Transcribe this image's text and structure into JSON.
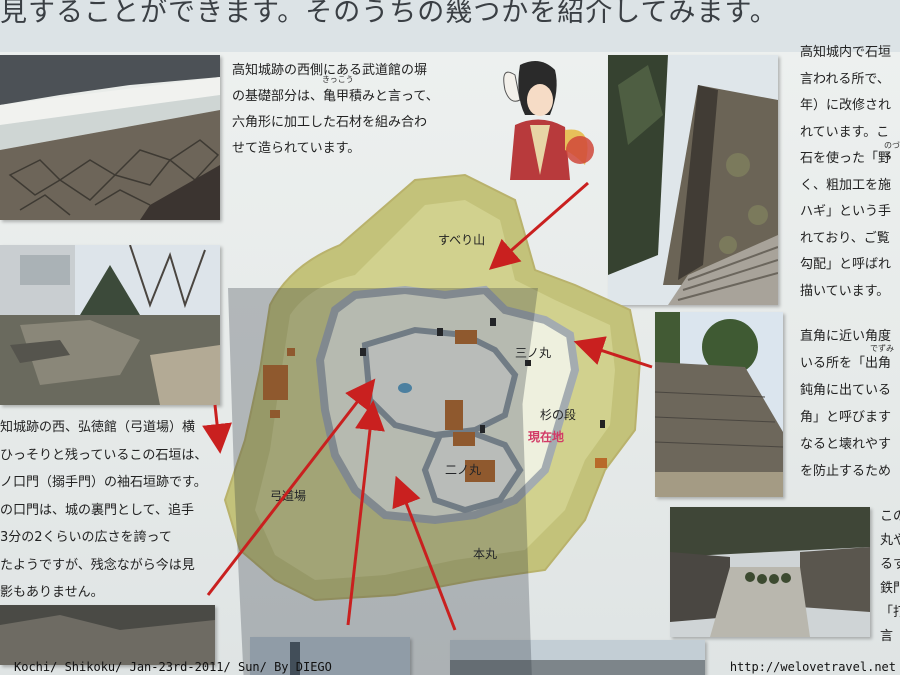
{
  "headline": "見することができます。そのうちの幾つかを紹介してみます。",
  "top_text": {
    "lines": [
      "高知城跡の西側にある武道館の塀",
      "の基礎部分は、亀甲積みと言って、",
      "六角形に加工した石材を組み合わ",
      "せて造られています。"
    ],
    "ruby": "きっこう"
  },
  "left_text": {
    "lines": [
      "知城跡の西、弘徳館（弓道場）横",
      "ひっそりと残っているこの石垣は、",
      "ノ口門（搦手門）の袖石垣跡です。",
      "の口門は、城の裏門として、追手",
      "3分の2くらいの広さを誇って",
      "たようですが、残念ながら今は見",
      "影もありません。"
    ]
  },
  "right_text_top": {
    "lines": [
      "高知城内で石垣",
      "言われる所で、",
      "年）に改修され",
      "れています。こ",
      "石を使った「野",
      "く、粗加工を施",
      "ハギ」という手",
      "れており、ご覧",
      "勾配」と呼ばれ",
      "描いています。"
    ],
    "ruby": "のづら"
  },
  "right_text_mid": {
    "lines": [
      "直角に近い角度",
      "いる所を「出角",
      "鈍角に出ている",
      "角」と呼びます",
      "なると壊れやす",
      "を防止するため"
    ],
    "ruby": "でずみ"
  },
  "right_text_bottom": {
    "lines": [
      "この",
      "丸や",
      "るす",
      "鉄門",
      "「打",
      "言"
    ]
  },
  "map_labels": {
    "suberi": "すべり山",
    "sannomaru": "三ノ丸",
    "suginodan": "杉の段",
    "current": "現在地",
    "ninomaru": "二ノ丸",
    "kyudojo": "弓道場",
    "honmaru": "本丸"
  },
  "footer": {
    "left": "Kochi/ Shikoku/ Jan-23rd-2011/ Sun/ By DIEGO",
    "right": "http://welovetravel.net"
  },
  "colors": {
    "map_fill": "#c3c27a",
    "map_edge": "#b9b26c",
    "path_fill": "#d9dbb4",
    "castle_gray": "#8e9aa2",
    "building_brown": "#b86a2a",
    "arrow_red": "#c9201f",
    "current_label": "#d23a66"
  }
}
